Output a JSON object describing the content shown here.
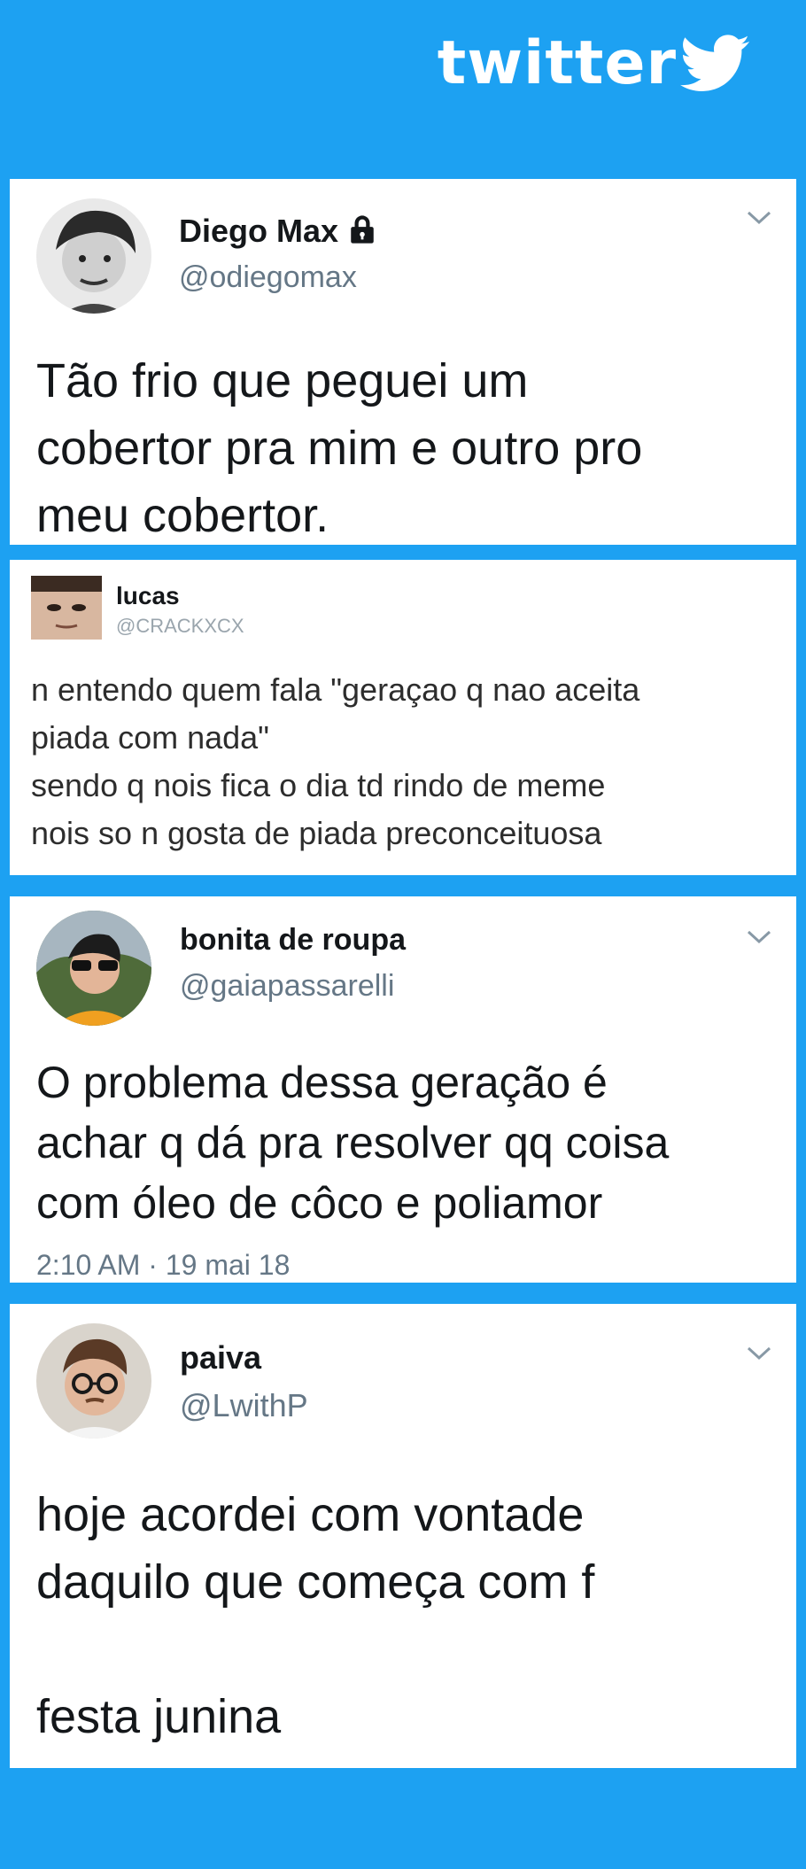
{
  "brand": {
    "logo_text": "twitter",
    "icon": "twitter-bird-icon",
    "accent": "#1da1f2"
  },
  "tweets": [
    {
      "name": "Diego Max",
      "handle": "@odiegomax",
      "verified_lock": true,
      "text": "Tão frio que peguei um\ncobertor pra mim e outro pro\nmeu cobertor."
    },
    {
      "name": "lucas",
      "handle": "@CRACKXCX",
      "text": "n entendo quem fala \"geraçao q nao aceita\npiada com nada\"\nsendo q nois fica o dia td rindo de meme\nnois so n gosta de piada preconceituosa"
    },
    {
      "name": "bonita de roupa",
      "handle": "@gaiapassarelli",
      "text": "O problema dessa geração é\nachar q dá pra resolver qq coisa\ncom óleo de côco e poliamor",
      "timestamp": "2:10 AM · 19 mai 18"
    },
    {
      "name": "paiva",
      "handle": "@LwithP",
      "text": "hoje acordei com vontade\ndaquilo que começa com f\n\nfesta junina"
    }
  ]
}
